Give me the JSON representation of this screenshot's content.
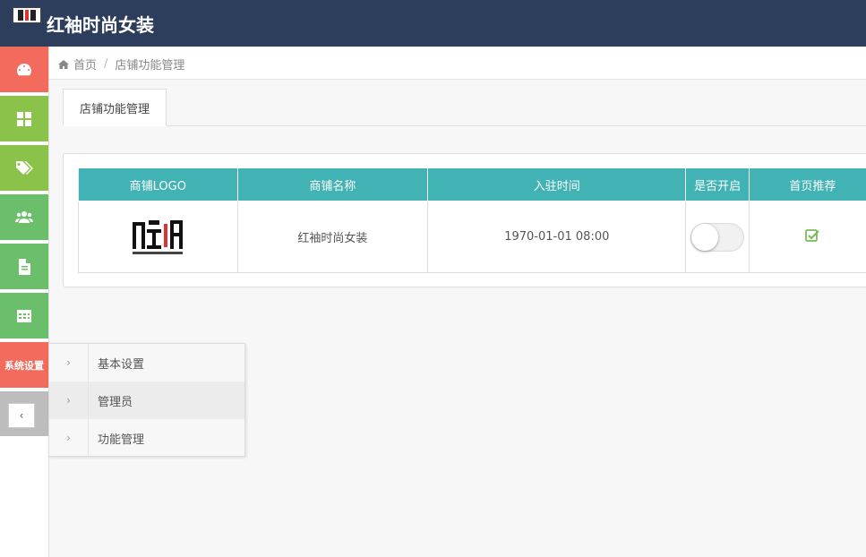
{
  "app": {
    "title": "红袖时尚女装"
  },
  "sidebar": {
    "items": [
      {
        "icon": "dashboard-icon"
      },
      {
        "icon": "grid-icon"
      },
      {
        "icon": "tags-icon"
      },
      {
        "icon": "users-icon"
      },
      {
        "icon": "file-icon"
      },
      {
        "icon": "table-icon"
      },
      {
        "label": "系统设置"
      }
    ],
    "collapse_label": "‹"
  },
  "breadcrumb": {
    "home": "首页",
    "sep": "/",
    "current": "店铺功能管理"
  },
  "tab": {
    "label": "店铺功能管理"
  },
  "table": {
    "headers": [
      "商铺LOGO",
      "商铺名称",
      "入驻时间",
      "是否开启",
      "首页推荐"
    ],
    "rows": [
      {
        "name": "红袖时尚女装",
        "time": "1970-01-01 08:00",
        "enabled": false,
        "recommended": true
      }
    ]
  },
  "flyout": {
    "items": [
      {
        "label": "基本设置"
      },
      {
        "label": "管理员"
      },
      {
        "label": "功能管理"
      }
    ],
    "chevron": "›"
  },
  "colors": {
    "topbar": "#2c3e5c",
    "table_header": "#41b3b4",
    "side_red": "#f26b5c",
    "side_green": "#8bc34a",
    "check_green": "#7cba5b"
  }
}
